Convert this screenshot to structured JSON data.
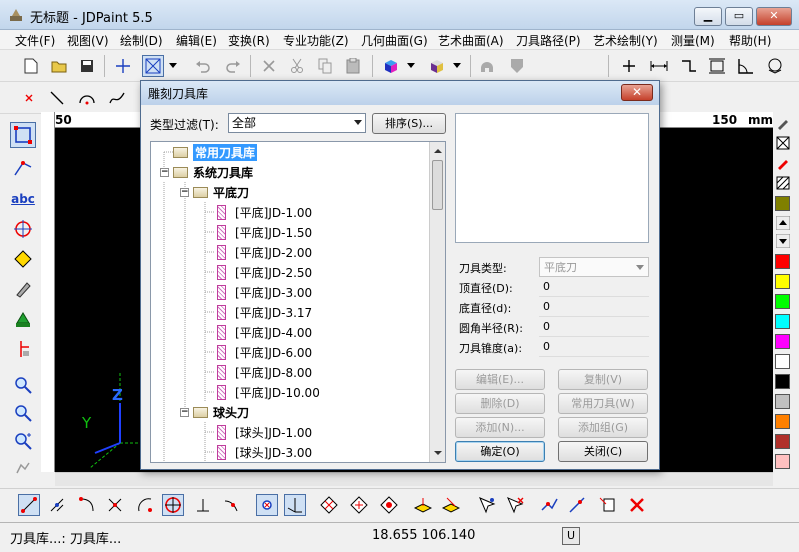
{
  "window": {
    "title": "无标题 - JDPaint 5.5",
    "min": "▁",
    "max": "▭",
    "close": "✕"
  },
  "menu": [
    "文件(F)",
    "视图(V)",
    "绘制(D)",
    "编辑(E)",
    "变换(R)",
    "专业功能(Z)",
    "几何曲面(G)",
    "艺术曲面(A)",
    "刀具路径(P)",
    "艺术绘制(Y)",
    "测量(M)",
    "帮助(H)"
  ],
  "ruler": {
    "left_mark": "50",
    "right_mark": "150",
    "unit": "mm"
  },
  "canvas_axes": {
    "y": "Y",
    "z": "Z"
  },
  "status": {
    "left": "刀具库...: 刀具库...",
    "coords": "18.655 106.140",
    "unit_btn": "U"
  },
  "palette_colors": [
    "#ff0000",
    "#ffff00",
    "#00ff00",
    "#00ffff",
    "#ff00ff",
    "#ffffff",
    "#000000",
    "#c0c0c0",
    "#ff8000",
    "#b0302a",
    "#ffc0c0"
  ],
  "dialog": {
    "title": "雕刻刀具库",
    "close": "✕",
    "filter_label": "类型过滤(T):",
    "filter_value": "全部",
    "sort_button": "排序(S)...",
    "tree": {
      "common_lib": "常用刀具库",
      "system_lib": "系统刀具库",
      "flat_group": "平底刀",
      "flat_tools": [
        "[平底]JD-1.00",
        "[平底]JD-1.50",
        "[平底]JD-2.00",
        "[平底]JD-2.50",
        "[平底]JD-3.00",
        "[平底]JD-3.17",
        "[平底]JD-4.00",
        "[平底]JD-6.00",
        "[平底]JD-8.00",
        "[平底]JD-10.00"
      ],
      "ball_group": "球头刀",
      "ball_tools": [
        "[球头]JD-1.00",
        "[球头]JD-3.00"
      ]
    },
    "props": [
      {
        "key": "刀具类型:",
        "value": "平底刀"
      },
      {
        "key": "顶直径(D):",
        "value": "0"
      },
      {
        "key": "底直径(d):",
        "value": "0"
      },
      {
        "key": "圆角半径(R):",
        "value": "0"
      },
      {
        "key": "刀具锥度(a):",
        "value": "0"
      }
    ],
    "buttons": {
      "edit": "编辑(E)...",
      "copy": "复制(V)",
      "delete": "删除(D)",
      "common": "常用刀具(W)",
      "add": "添加(N)...",
      "add_group": "添加组(G)",
      "ok": "确定(O)",
      "close": "关闭(C)"
    }
  }
}
